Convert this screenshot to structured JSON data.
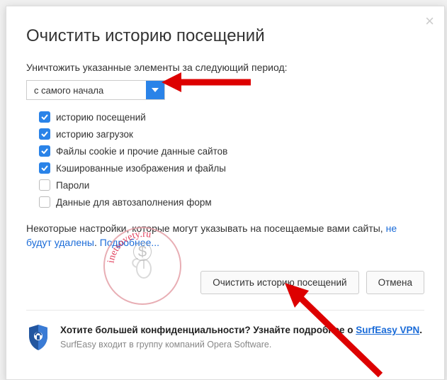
{
  "dialog": {
    "title": "Очистить историю посещений",
    "period_label": "Уничтожить указанные элементы за следующий период:",
    "period_value": "с самого начала",
    "checkboxes": [
      {
        "label": "историю посещений",
        "checked": true
      },
      {
        "label": "историю загрузок",
        "checked": true
      },
      {
        "label": "Файлы cookie и прочие данные сайтов",
        "checked": true
      },
      {
        "label": "Кэшированные изображения и файлы",
        "checked": true
      },
      {
        "label": "Пароли",
        "checked": false
      },
      {
        "label": "Данные для автозаполнения форм",
        "checked": false
      }
    ],
    "note_text": "Некоторые настройки, которые могут указывать на посещаемые вами сайты, ",
    "note_link1": "не будут удалены",
    "note_sep": ". ",
    "note_link2": "Подробнее...",
    "btn_clear": "Очистить историю посещений",
    "btn_cancel": "Отмена"
  },
  "footer": {
    "line1a": "Хотите большей конфиденциальности? Узнайте подробнее о ",
    "vpn_link": "SurfEasy VPN",
    "dot": ".",
    "line2": "SurfEasy входит в группу компаний Opera Software."
  },
  "watermark": {
    "text": "inetsovety.ru"
  }
}
